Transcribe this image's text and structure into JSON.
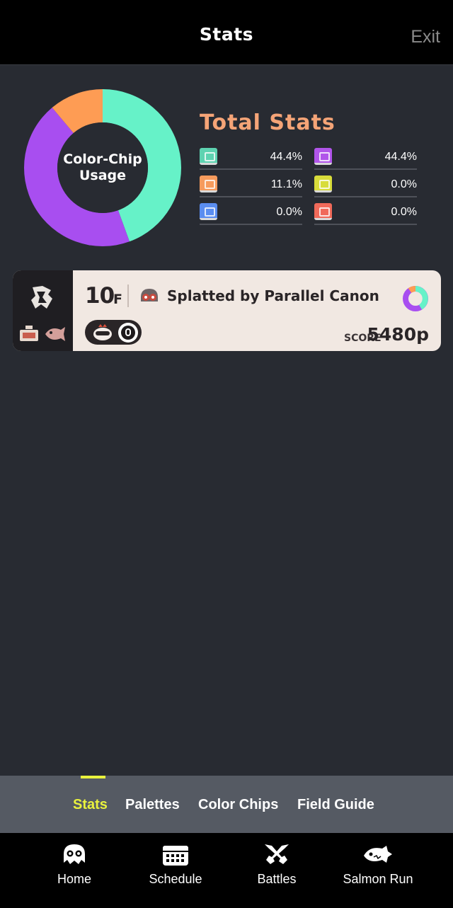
{
  "header": {
    "title": "Stats",
    "exit_label": "Exit"
  },
  "usage_chart": {
    "label_line1": "Color-Chip",
    "label_line2": "Usage"
  },
  "chart_data": {
    "type": "pie",
    "title": "Color-Chip Usage",
    "categories": [
      "Teal",
      "Purple",
      "Orange"
    ],
    "values": [
      44.4,
      44.4,
      11.1
    ],
    "colors": [
      "#66f2c8",
      "#a84ef0",
      "#fe9c54"
    ]
  },
  "total_stats": {
    "title": "Total Stats",
    "items": [
      {
        "icon": "teal-chip-icon",
        "color": "#5ed3b1",
        "value": "44.4%"
      },
      {
        "icon": "purple-chip-icon",
        "color": "#b155ea",
        "value": "44.4%"
      },
      {
        "icon": "orange-chip-icon",
        "color": "#f69b5d",
        "value": "11.1%"
      },
      {
        "icon": "yellow-chip-icon",
        "color": "#d8dc3b",
        "value": "0.0%"
      },
      {
        "icon": "blue-chip-icon",
        "color": "#5a8df0",
        "value": "0.0%"
      },
      {
        "icon": "red-chip-icon",
        "color": "#f06a5a",
        "value": "0.0%"
      }
    ]
  },
  "run_card": {
    "floor_number": "10",
    "floor_unit": "F",
    "result_text": "Splatted by Parallel Canon",
    "score_label": "SCORE",
    "score_value": "5480p"
  },
  "subtabs": {
    "items": [
      {
        "label": "Stats",
        "active": true
      },
      {
        "label": "Palettes",
        "active": false
      },
      {
        "label": "Color Chips",
        "active": false
      },
      {
        "label": "Field Guide",
        "active": false
      }
    ]
  },
  "bottom_nav": {
    "items": [
      {
        "label": "Home",
        "icon": "squid-icon"
      },
      {
        "label": "Schedule",
        "icon": "calendar-icon"
      },
      {
        "label": "Battles",
        "icon": "crossed-weapons-icon"
      },
      {
        "label": "Salmon Run",
        "icon": "salmon-icon"
      }
    ]
  }
}
